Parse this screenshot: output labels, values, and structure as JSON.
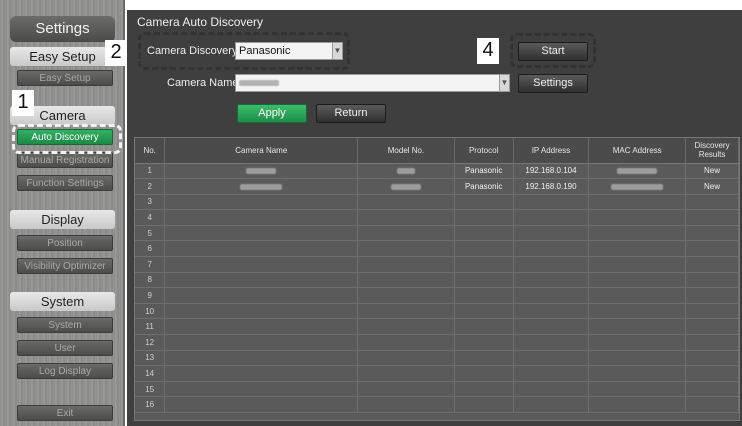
{
  "sidebar": {
    "title": "Settings",
    "sections": {
      "easy_setup": {
        "label": "Easy Setup",
        "items": [
          "Easy Setup"
        ]
      },
      "camera": {
        "label": "Camera",
        "items": [
          "Auto Discovery",
          "Manual Registration",
          "Function Settings"
        ]
      },
      "display": {
        "label": "Display",
        "items": [
          "Position",
          "Visibility Optimizer"
        ]
      },
      "system": {
        "label": "System",
        "items": [
          "System",
          "User",
          "Log Display"
        ]
      }
    },
    "exit": "Exit"
  },
  "main": {
    "title": "Camera Auto Discovery",
    "discovery_label": "Camera Discovery",
    "discovery_value": "Panasonic",
    "camera_name_label": "Camera Name",
    "buttons": {
      "start": "Start",
      "settings": "Settings",
      "apply": "Apply",
      "return": "Return"
    }
  },
  "callouts": [
    "1",
    "2",
    "4"
  ],
  "table": {
    "headers": [
      "No.",
      "Camera Name",
      "Model No.",
      "Protocol",
      "IP Address",
      "MAC Address",
      "Discovery Results"
    ],
    "rows": [
      [
        "1",
        "",
        "",
        "Panasonic",
        "192.168.0.104",
        "",
        "New"
      ],
      [
        "2",
        "",
        "",
        "Panasonic",
        "192.168.0.190",
        "",
        "New"
      ],
      [
        "3",
        "",
        "",
        "",
        "",
        "",
        ""
      ],
      [
        "4",
        "",
        "",
        "",
        "",
        "",
        ""
      ],
      [
        "5",
        "",
        "",
        "",
        "",
        "",
        ""
      ],
      [
        "6",
        "",
        "",
        "",
        "",
        "",
        ""
      ],
      [
        "7",
        "",
        "",
        "",
        "",
        "",
        ""
      ],
      [
        "8",
        "",
        "",
        "",
        "",
        "",
        ""
      ],
      [
        "9",
        "",
        "",
        "",
        "",
        "",
        ""
      ],
      [
        "10",
        "",
        "",
        "",
        "",
        "",
        ""
      ],
      [
        "11",
        "",
        "",
        "",
        "",
        "",
        ""
      ],
      [
        "12",
        "",
        "",
        "",
        "",
        "",
        ""
      ],
      [
        "13",
        "",
        "",
        "",
        "",
        "",
        ""
      ],
      [
        "14",
        "",
        "",
        "",
        "",
        "",
        ""
      ],
      [
        "15",
        "",
        "",
        "",
        "",
        "",
        ""
      ],
      [
        "16",
        "",
        "",
        "",
        "",
        "",
        ""
      ]
    ]
  },
  "colors": {
    "accent_green": "#1e8e48",
    "panel": "#3f3f3f"
  }
}
